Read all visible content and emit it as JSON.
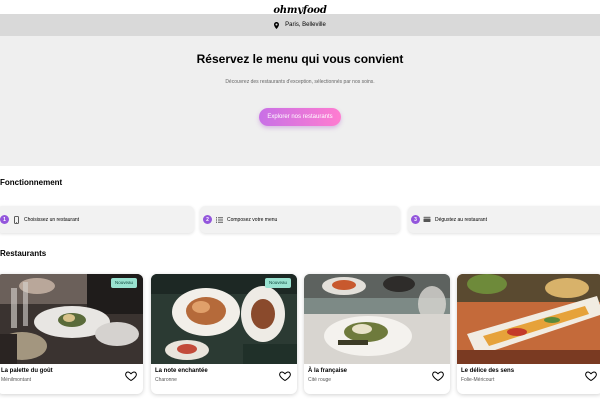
{
  "header": {
    "logo": "ohmyfood"
  },
  "location": {
    "icon": "location-pin-icon",
    "text": "Paris, Belleville"
  },
  "hero": {
    "title": "Réservez le menu qui vous convient",
    "subtitle": "Découvrez des restaurants d'exception, sélectionnés par nos soins.",
    "cta_label": "Explorer nos restaurants"
  },
  "fonctionnement": {
    "title": "Fonctionnement",
    "steps": [
      {
        "number": "1",
        "icon": "phone-icon",
        "label": "Choisissez un restaurant"
      },
      {
        "number": "2",
        "icon": "list-icon",
        "label": "Composez votre menu"
      },
      {
        "number": "3",
        "icon": "utensils-icon",
        "label": "Dégustez au restaurant"
      }
    ]
  },
  "restaurants": {
    "title": "Restaurants",
    "items": [
      {
        "name": "La palette du goût",
        "area": "Ménilmontant",
        "badge": "Nouveau"
      },
      {
        "name": "La note enchantée",
        "area": "Charonne",
        "badge": "Nouveau"
      },
      {
        "name": "À la française",
        "area": "Cité rouge",
        "badge": ""
      },
      {
        "name": "Le délice des sens",
        "area": "Folie-Méricourt",
        "badge": ""
      }
    ]
  },
  "colors": {
    "accent": "#9356dc",
    "cta_start": "#c870e6",
    "cta_end": "#ff7cd0",
    "badge_bg": "#99e2d0"
  }
}
